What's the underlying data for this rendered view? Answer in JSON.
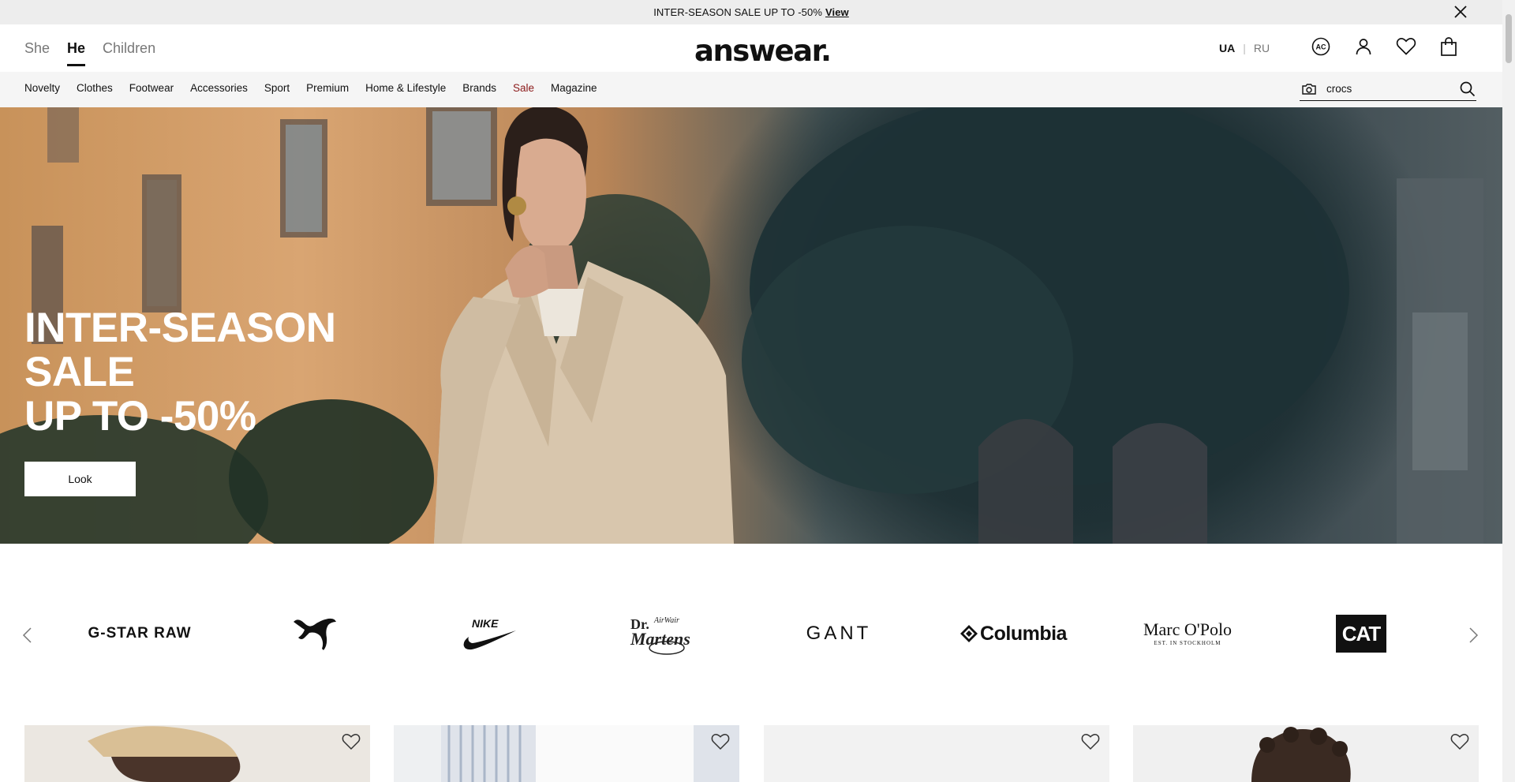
{
  "promo": {
    "text": "INTER-SEASON SALE UP TO -50%",
    "link": "View",
    "close_icon": "close-icon"
  },
  "header": {
    "gender_tabs": [
      {
        "label": "She",
        "active": false
      },
      {
        "label": "He",
        "active": true
      },
      {
        "label": "Children",
        "active": false
      }
    ],
    "logo": "answear.",
    "languages": [
      {
        "code": "UA",
        "active": true
      },
      {
        "code": "RU",
        "active": false
      }
    ],
    "icons": [
      "answear-club-icon",
      "user-icon",
      "heart-icon",
      "shopping-bag-icon"
    ]
  },
  "nav": {
    "items": [
      {
        "label": "Novelty"
      },
      {
        "label": "Clothes"
      },
      {
        "label": "Footwear"
      },
      {
        "label": "Accessories"
      },
      {
        "label": "Sport"
      },
      {
        "label": "Premium"
      },
      {
        "label": "Home & Lifestyle"
      },
      {
        "label": "Brands"
      },
      {
        "label": "Sale",
        "highlight": true
      },
      {
        "label": "Magazine"
      }
    ],
    "search": {
      "value": "crocs",
      "camera_icon": "camera-icon",
      "search_icon": "search-icon"
    }
  },
  "hero": {
    "title_lines": [
      "INTER-SEASON",
      "SALE",
      "UP TO -50%"
    ],
    "cta_label": "Look"
  },
  "brands": {
    "items": [
      "G-STAR RAW",
      "PUMA",
      "NIKE",
      "Dr. Martens AirWair",
      "GANT",
      "Columbia",
      "Marc O'Polo",
      "CAT"
    ],
    "marc_opolo_sub": "EST. IN STOCKHOLM",
    "drmartens_top": "AirWair",
    "drmartens_main": "Dr. Martens"
  },
  "products": {
    "count": 4,
    "wishlist_icon": "heart-outline-icon"
  },
  "colors": {
    "promo_bg": "#ededed",
    "nav_bg": "#f5f5f5",
    "sale_red": "#8b1a1a",
    "text": "#111111"
  }
}
